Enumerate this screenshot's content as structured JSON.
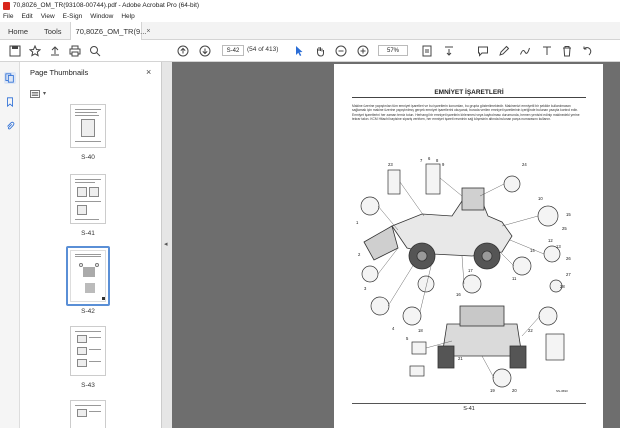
{
  "window": {
    "title": "70,80Z6_OM_TR(93108-00744).pdf - Adobe Acrobat Pro (64-bit)"
  },
  "menu": [
    "File",
    "Edit",
    "View",
    "E-Sign",
    "Window",
    "Help"
  ],
  "tabs": {
    "home": "Home",
    "tools": "Tools",
    "document": "70,80Z6_OM_TR(9...",
    "close": "×"
  },
  "toolbar": {
    "page_value": "S-42",
    "page_of": "(54 of 413)",
    "zoom": "57%"
  },
  "panel": {
    "title": "Page Thumbnails",
    "close": "×"
  },
  "thumbnails": [
    {
      "label": "S-40"
    },
    {
      "label": "S-41"
    },
    {
      "label": "S-42",
      "selected": true
    },
    {
      "label": "S-43"
    }
  ],
  "page": {
    "heading": "EMNİYET İŞARETLERİ",
    "body": "Makine üzerine yapıştırılan tüm emniyet işaretleri ve bu işaretlerin konumları, bu grupta gösterilmektedir. Makinenizi emniyetli bir şekilde kullanılmasını sağlamak için makine üzerine yapıştırılmış gerçek emniyet işaretlerini okuyarak, burada verilen emniyet işaretlerinin içeriğinde bulunan yazıyla kontrol edin. Emniyet işaretlerini her zaman temiz tutun. Herhangi bir emniyet işaretinin kirlenmesi veya kaybolması durumunda, hemen yenisini edinip makinedeki yerine tekrar takın. KCM Hitachi bayisine sipariş verirken, her emniyet işareti resminin sağ köşesinin altında bulunan parça numarasını kullanın.",
    "page_number": "S-41",
    "figure_code": "SS-3693"
  },
  "callouts": [
    "23",
    "1",
    "7",
    "6",
    "8",
    "9",
    "24",
    "2",
    "3",
    "4",
    "10",
    "12",
    "13",
    "14",
    "15",
    "16",
    "17",
    "18",
    "19",
    "20",
    "21",
    "22",
    "25",
    "26",
    "27",
    "28",
    "5",
    "11"
  ],
  "colors": {
    "accent": "#2a6dd6",
    "viewer_bg": "#6e6e6e",
    "pdf_red": "#d8261c"
  }
}
